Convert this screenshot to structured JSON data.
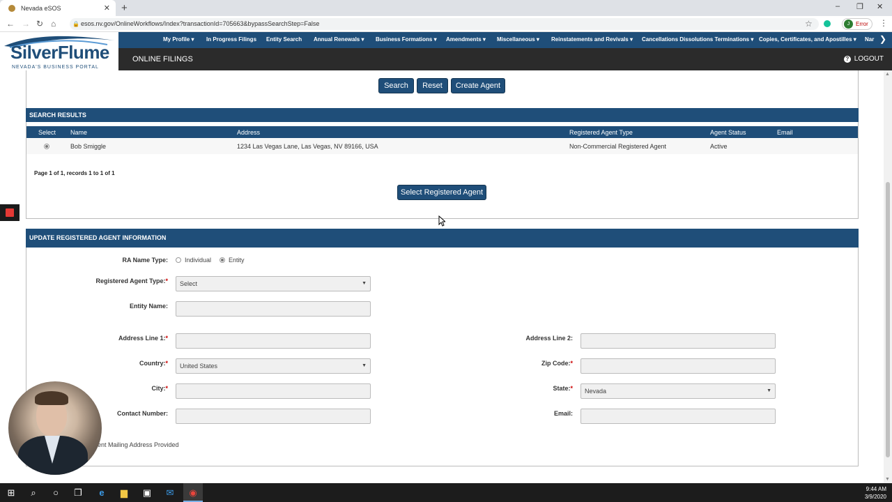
{
  "browser": {
    "tab_title": "Nevada eSOS",
    "url": "esos.nv.gov/OnlineWorkflows/Index?transactionId=705663&bypassSearchStep=False",
    "profile_label": "Error",
    "profile_initial": "J"
  },
  "header": {
    "logo_text": "SilverFlume",
    "logo_sub": "NEVADA'S BUSINESS PORTAL",
    "menu": [
      "My Profile",
      "In Progress Filings",
      "Entity Search",
      "Annual Renewals",
      "Business Formations",
      "Amendments",
      "Miscellaneous",
      "Reinstatements and Revivals",
      "Cancellations Dissolutions Terminations",
      "Copies, Certificates, and Apostilles",
      "Nar"
    ],
    "section_title": "ONLINE FILINGS",
    "logout_label": "LOGOUT"
  },
  "search_actions": {
    "search": "Search",
    "reset": "Reset",
    "create_agent": "Create Agent"
  },
  "results": {
    "title": "SEARCH RESULTS",
    "columns": [
      "Select",
      "Name",
      "Address",
      "Registered Agent Type",
      "Agent Status",
      "Email"
    ],
    "rows": [
      {
        "name": "Bob Smiggle",
        "address": "1234 Las Vegas Lane, Las Vegas, NV 89166, USA",
        "type": "Non-Commercial Registered Agent",
        "status": "Active",
        "email": ""
      }
    ],
    "page_info": "Page 1 of 1, records 1 to 1 of 1",
    "select_button": "Select Registered Agent"
  },
  "update_form": {
    "title": "UPDATE REGISTERED AGENT INFORMATION",
    "ra_name_type_label": "RA Name Type:",
    "ra_option_individual": "Individual",
    "ra_option_entity": "Entity",
    "agent_type_label": "Registered Agent Type:",
    "agent_type_value": "Select",
    "entity_name_label": "Entity Name:",
    "address1_label": "Address Line 1:",
    "address2_label": "Address Line 2:",
    "country_label": "Country:",
    "country_value": "United States",
    "zip_label": "Zip Code:",
    "city_label": "City:",
    "state_label": "State:",
    "state_value": "Nevada",
    "contact_label": "Contact Number:",
    "email_label": "Email:",
    "mailing_text": "ent Mailing Address Provided"
  },
  "taskbar": {
    "time": "9:44 AM",
    "date": "3/9/2020"
  }
}
